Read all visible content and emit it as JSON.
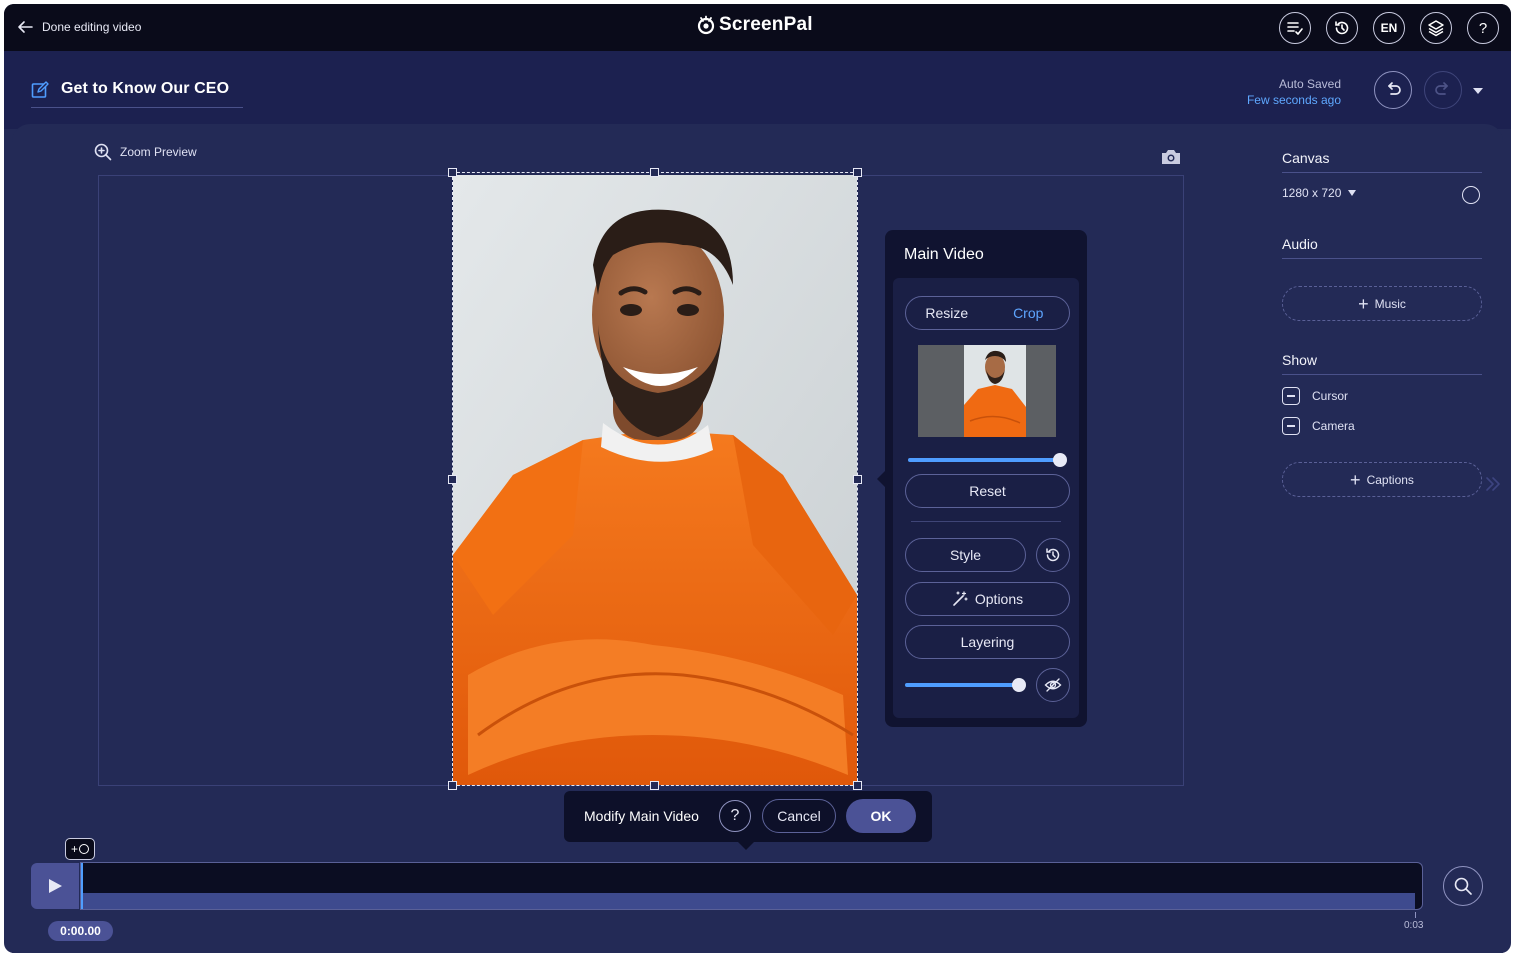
{
  "topbar": {
    "back_label": "Done editing video",
    "logo_text": "ScreenPal",
    "language": "EN",
    "help": "?"
  },
  "project": {
    "title": "Get to Know Our CEO",
    "autosave_status": "Auto Saved",
    "autosave_time": "Few seconds ago"
  },
  "preview": {
    "zoom_label": "Zoom Preview"
  },
  "main_video_panel": {
    "title": "Main Video",
    "resize_label": "Resize",
    "crop_label": "Crop",
    "reset_label": "Reset",
    "style_label": "Style",
    "options_label": "Options",
    "layering_label": "Layering",
    "scale_value": 1.0,
    "opacity_value": 1.0
  },
  "sidebar": {
    "canvas_header": "Canvas",
    "canvas_size": "1280 x 720",
    "audio_header": "Audio",
    "music_label": "Music",
    "show_header": "Show",
    "cursor_label": "Cursor",
    "camera_label": "Camera",
    "captions_label": "Captions"
  },
  "modify_bar": {
    "title": "Modify Main Video",
    "help": "?",
    "cancel_label": "Cancel",
    "ok_label": "OK"
  },
  "timeline": {
    "current_time": "0:00.00",
    "end_time": "0:03",
    "add_plus": "+"
  },
  "colors": {
    "background": "#232a56",
    "topbar": "#0a0b1a",
    "accent": "#4f9dff",
    "sweater": "#f06a12"
  }
}
